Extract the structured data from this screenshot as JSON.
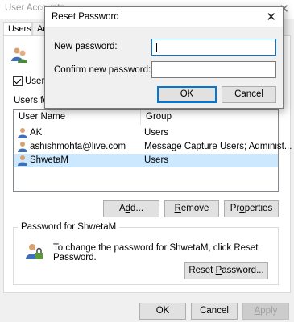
{
  "main_window": {
    "title": "User Accounts",
    "close_glyph": "✕",
    "tabs": [
      {
        "label": "Users",
        "active": true
      },
      {
        "label": "Adv",
        "active": false
      }
    ],
    "users_must_enter_checkbox": {
      "label": "Users m",
      "checked": true
    },
    "users_for_label": "Users for",
    "list": {
      "columns": [
        "User Name",
        "Group"
      ],
      "rows": [
        {
          "user": "AK",
          "group": "Users",
          "selected": false
        },
        {
          "user": "ashishmohta@live.com",
          "group": "Message Capture Users; Administ...",
          "selected": false
        },
        {
          "user": "ShwetaM",
          "group": "Users",
          "selected": true
        }
      ]
    },
    "list_buttons": {
      "add": {
        "prefix": "A",
        "mnemonic": "d",
        "suffix": "d..."
      },
      "remove": {
        "prefix": "",
        "mnemonic": "R",
        "suffix": "emove"
      },
      "properties": {
        "prefix": "Pr",
        "mnemonic": "o",
        "suffix": "perties"
      }
    },
    "password_group": {
      "legend": "Password for ShwetaM",
      "info": "To change the password for ShwetaM, click Reset Password.",
      "reset_button": {
        "prefix": "Reset ",
        "mnemonic": "P",
        "suffix": "assword..."
      }
    },
    "footer": {
      "ok": "OK",
      "cancel": "Cancel",
      "apply": {
        "prefix": "",
        "mnemonic": "A",
        "suffix": "pply",
        "enabled": false
      }
    }
  },
  "reset_dialog": {
    "title": "Reset Password",
    "close_glyph": "✕",
    "new_password_label": "New password:",
    "new_password_value": "",
    "confirm_password_label": "Confirm new password:",
    "confirm_password_value": "",
    "ok_label": "OK",
    "cancel_label": "Cancel"
  },
  "colors": {
    "accent_focus": "#0078d7",
    "selection": "#cce8ff",
    "dialog_bg": "#f0f0f0",
    "button_bg": "#e1e1e1"
  },
  "icons": [
    "users-icon",
    "user-icon",
    "password-user-icon",
    "close-icon"
  ]
}
